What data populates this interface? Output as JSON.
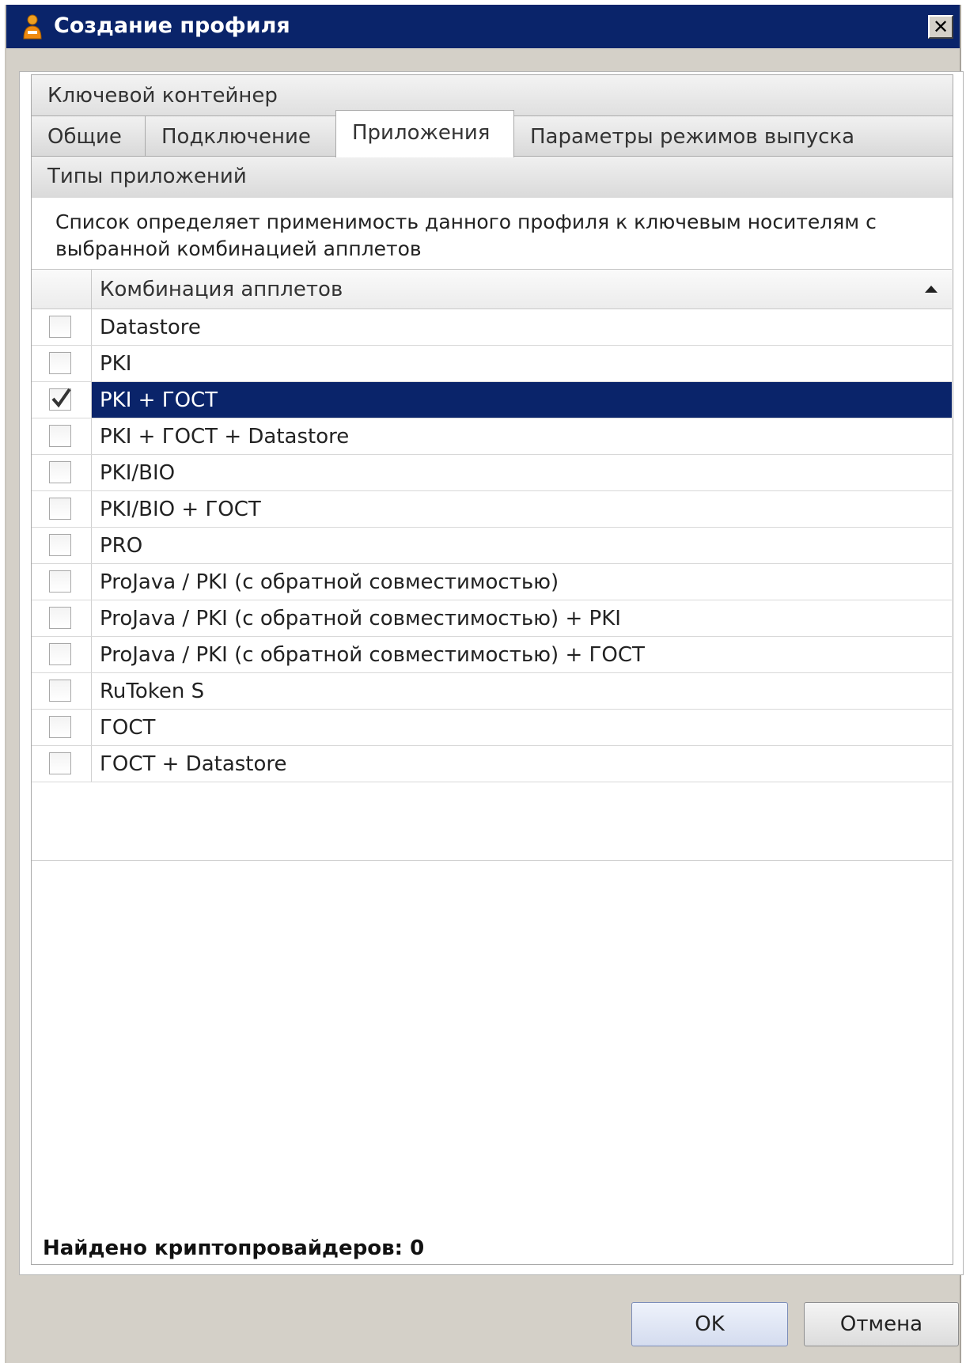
{
  "window": {
    "title": "Создание профиля",
    "close_glyph": "✕"
  },
  "tabs_top": {
    "label": "Ключевой контейнер"
  },
  "tabs": [
    {
      "label": "Общие",
      "active": false
    },
    {
      "label": "Подключение",
      "active": false
    },
    {
      "label": "Приложения",
      "active": true
    },
    {
      "label": "Параметры режимов выпуска",
      "active": false
    }
  ],
  "panel": {
    "group_title": "Типы приложений",
    "description": "Список определяет применимость данного профиля к ключевым носителям с выбранной комбинацией апплетов"
  },
  "grid": {
    "column_header": "Комбинация апплетов",
    "sort": "ascending",
    "rows": [
      {
        "label": "Datastore",
        "checked": false,
        "selected": false
      },
      {
        "label": "PKI",
        "checked": false,
        "selected": false
      },
      {
        "label": "PKI + ГОСТ",
        "checked": true,
        "selected": true
      },
      {
        "label": "PKI + ГОСТ + Datastore",
        "checked": false,
        "selected": false
      },
      {
        "label": "PKI/BIO",
        "checked": false,
        "selected": false
      },
      {
        "label": "PKI/BIO + ГОСТ",
        "checked": false,
        "selected": false
      },
      {
        "label": "PRO",
        "checked": false,
        "selected": false
      },
      {
        "label": "ProJava / PKI (с обратной совместимостью)",
        "checked": false,
        "selected": false
      },
      {
        "label": "ProJava / PKI (с обратной совместимостью) + PKI",
        "checked": false,
        "selected": false
      },
      {
        "label": "ProJava / PKI (с обратной совместимостью) + ГОСТ",
        "checked": false,
        "selected": false
      },
      {
        "label": "RuToken S",
        "checked": false,
        "selected": false
      },
      {
        "label": "ГОСТ",
        "checked": false,
        "selected": false
      },
      {
        "label": "ГОСТ + Datastore",
        "checked": false,
        "selected": false
      }
    ]
  },
  "footer": {
    "count_text": "Найдено криптопровайдеров: 0"
  },
  "buttons": {
    "ok_label": "OK",
    "cancel_label": "Отмена"
  },
  "colors": {
    "titlebar": "#0a246a",
    "selection": "#0a246a",
    "dialog_bg": "#d4d0c8"
  }
}
